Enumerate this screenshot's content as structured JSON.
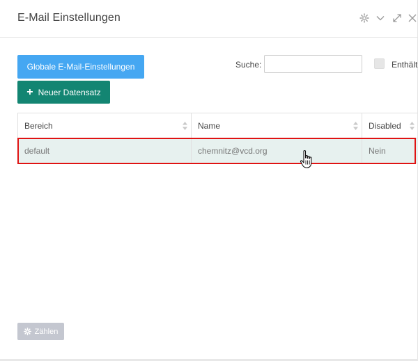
{
  "window": {
    "title": "E-Mail Einstellungen"
  },
  "toolbar": {
    "global_settings_label": "Globale E-Mail-Einstellungen",
    "new_record_label": "Neuer Datensatz",
    "search_label": "Suche:",
    "search_value": "",
    "contains_label": "Enthält"
  },
  "table": {
    "columns": [
      "Bereich",
      "Name",
      "Disabled"
    ],
    "rows": [
      {
        "bereich": "default",
        "name": "chemnitz@vcd.org",
        "disabled": "Nein"
      }
    ]
  },
  "footer": {
    "count_label": "Zählen"
  },
  "colors": {
    "primary_blue": "#45a7f2",
    "primary_green": "#138572",
    "highlight_red": "#e01313",
    "selected_row": "#e7f1ef"
  },
  "icons": [
    "gear-icon",
    "chevron-down-icon",
    "expand-icon",
    "close-icon",
    "plus-icon",
    "sort-icon",
    "hand-cursor-icon"
  ]
}
